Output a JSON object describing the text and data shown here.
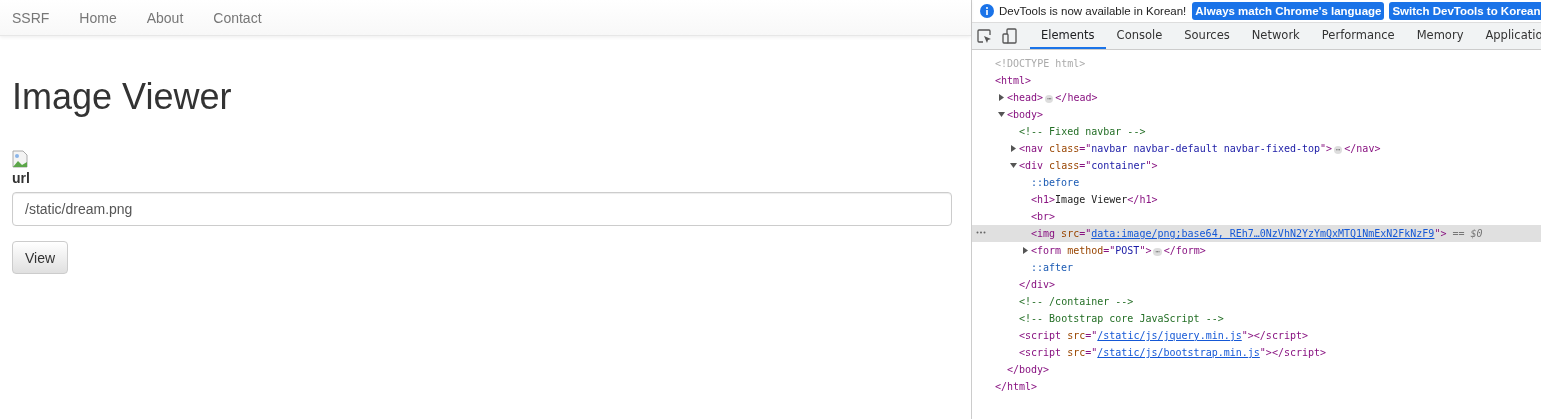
{
  "navbar": {
    "brand": "SSRF",
    "links": [
      {
        "label": "Home"
      },
      {
        "label": "About"
      },
      {
        "label": "Contact"
      }
    ]
  },
  "page": {
    "title": "Image Viewer",
    "field_label": "url",
    "url_field": {
      "value": "/static/dream.png"
    },
    "view_button": "View"
  },
  "devtools": {
    "infobar": {
      "message": "DevTools is now available in Korean!",
      "buttons": [
        "Always match Chrome's language",
        "Switch DevTools to Korean"
      ]
    },
    "tabs": [
      {
        "label": "Elements",
        "selected": true
      },
      {
        "label": "Console",
        "selected": false
      },
      {
        "label": "Sources",
        "selected": false
      },
      {
        "label": "Network",
        "selected": false
      },
      {
        "label": "Performance",
        "selected": false
      },
      {
        "label": "Memory",
        "selected": false
      },
      {
        "label": "Applicatio",
        "selected": false
      }
    ],
    "dom_tree": [
      {
        "selected": false,
        "parts": [
          {
            "kind": "doctype",
            "text": "<!DOCTYPE html>"
          }
        ]
      },
      {
        "selected": false,
        "parts": [
          {
            "kind": "tag",
            "text": "<html>"
          }
        ],
        "closing": [
          {
            "kind": "tag",
            "text": "</html>"
          }
        ],
        "children": [
          {
            "selected": false,
            "expanded": false,
            "parts": [
              {
                "kind": "tag",
                "text": "<head>"
              },
              {
                "kind": "ellipsis",
                "text": "⋯"
              },
              {
                "kind": "tag",
                "text": "</head>"
              }
            ]
          },
          {
            "selected": false,
            "expanded": true,
            "parts": [
              {
                "kind": "tag",
                "text": "<body>"
              }
            ],
            "closing": [
              {
                "kind": "tag",
                "text": "</body>"
              }
            ],
            "children": [
              {
                "selected": false,
                "parts": [
                  {
                    "kind": "comment",
                    "text": "<!-- Fixed navbar -->"
                  }
                ]
              },
              {
                "selected": false,
                "expanded": false,
                "parts": [
                  {
                    "kind": "tag",
                    "text": "<nav "
                  },
                  {
                    "kind": "attr",
                    "text": "class"
                  },
                  {
                    "kind": "tag",
                    "text": "=\""
                  },
                  {
                    "kind": "value",
                    "text": "navbar navbar-default navbar-fixed-top"
                  },
                  {
                    "kind": "tag",
                    "text": "\">"
                  },
                  {
                    "kind": "ellipsis",
                    "text": "⋯"
                  },
                  {
                    "kind": "tag",
                    "text": "</nav>"
                  }
                ]
              },
              {
                "selected": false,
                "expanded": true,
                "parts": [
                  {
                    "kind": "tag",
                    "text": "<div "
                  },
                  {
                    "kind": "attr",
                    "text": "class"
                  },
                  {
                    "kind": "tag",
                    "text": "=\""
                  },
                  {
                    "kind": "value",
                    "text": "container"
                  },
                  {
                    "kind": "tag",
                    "text": "\">"
                  }
                ],
                "closing": [
                  {
                    "kind": "tag",
                    "text": "</div>"
                  }
                ],
                "children": [
                  {
                    "selected": false,
                    "parts": [
                      {
                        "kind": "pseudo",
                        "text": "::before"
                      }
                    ]
                  },
                  {
                    "selected": false,
                    "parts": [
                      {
                        "kind": "tag",
                        "text": "<h1>"
                      },
                      {
                        "kind": "text",
                        "text": "Image Viewer"
                      },
                      {
                        "kind": "tag",
                        "text": "</h1>"
                      }
                    ]
                  },
                  {
                    "selected": false,
                    "parts": [
                      {
                        "kind": "tag",
                        "text": "<br>"
                      }
                    ]
                  },
                  {
                    "selected": true,
                    "parts": [
                      {
                        "kind": "tag",
                        "text": "<img "
                      },
                      {
                        "kind": "attr",
                        "text": "src"
                      },
                      {
                        "kind": "tag",
                        "text": "=\""
                      },
                      {
                        "kind": "link",
                        "text": "data:image/png;base64, REh7…0NzVhN2YzYmQxMTQ1NmExN2FkNzF9"
                      },
                      {
                        "kind": "tag",
                        "text": "\">"
                      },
                      {
                        "kind": "ref",
                        "text": "== $0"
                      }
                    ]
                  },
                  {
                    "selected": false,
                    "expanded": false,
                    "parts": [
                      {
                        "kind": "tag",
                        "text": "<form "
                      },
                      {
                        "kind": "attr",
                        "text": "method"
                      },
                      {
                        "kind": "tag",
                        "text": "=\""
                      },
                      {
                        "kind": "value",
                        "text": "POST"
                      },
                      {
                        "kind": "tag",
                        "text": "\">"
                      },
                      {
                        "kind": "ellipsis",
                        "text": "⋯"
                      },
                      {
                        "kind": "tag",
                        "text": "</form>"
                      }
                    ]
                  },
                  {
                    "selected": false,
                    "parts": [
                      {
                        "kind": "pseudo",
                        "text": "::after"
                      }
                    ]
                  }
                ]
              },
              {
                "selected": false,
                "parts": [
                  {
                    "kind": "comment",
                    "text": "<!-- /container -->"
                  }
                ]
              },
              {
                "selected": false,
                "parts": [
                  {
                    "kind": "comment",
                    "text": "<!-- Bootstrap core JavaScript -->"
                  }
                ]
              },
              {
                "selected": false,
                "parts": [
                  {
                    "kind": "tag",
                    "text": "<script "
                  },
                  {
                    "kind": "attr",
                    "text": "src"
                  },
                  {
                    "kind": "tag",
                    "text": "=\""
                  },
                  {
                    "kind": "link",
                    "text": "/static/js/jquery.min.js"
                  },
                  {
                    "kind": "tag",
                    "text": "\"></script>"
                  }
                ]
              },
              {
                "selected": false,
                "parts": [
                  {
                    "kind": "tag",
                    "text": "<script "
                  },
                  {
                    "kind": "attr",
                    "text": "src"
                  },
                  {
                    "kind": "tag",
                    "text": "=\""
                  },
                  {
                    "kind": "link",
                    "text": "/static/js/bootstrap.min.js"
                  },
                  {
                    "kind": "tag",
                    "text": "\"></script>"
                  }
                ]
              }
            ]
          }
        ]
      }
    ]
  }
}
